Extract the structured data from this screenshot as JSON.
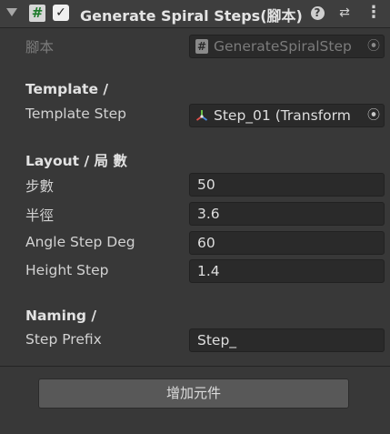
{
  "header": {
    "title": "Generate Spiral Steps(腳本)",
    "script_glyph": "#",
    "checkbox_glyph": "✓",
    "help_glyph": "?",
    "preset_glyph": "⇄",
    "menu_glyph": "⋮"
  },
  "script_field": {
    "label": "腳本",
    "icon_glyph": "#",
    "value": "GenerateSpiralStep",
    "picker_glyph": "⦿"
  },
  "template": {
    "header": "Template /",
    "step_label": "Template Step",
    "step_value": "Step_01 (Transform",
    "picker_glyph": "⦿"
  },
  "layout": {
    "header": "Layout / 局 數",
    "fields": [
      {
        "label": "步數",
        "value": "50"
      },
      {
        "label": "半徑",
        "value": "3.6"
      },
      {
        "label": "Angle Step Deg",
        "value": "60"
      },
      {
        "label": "Height Step",
        "value": "1.4"
      }
    ]
  },
  "naming": {
    "header": "Naming /",
    "prefix_label": "Step Prefix",
    "prefix_value": "Step_"
  },
  "add_component_label": "增加元件",
  "colors": {
    "background": "#383838",
    "field_bg": "#2a2a2a",
    "button_bg": "#585858"
  }
}
